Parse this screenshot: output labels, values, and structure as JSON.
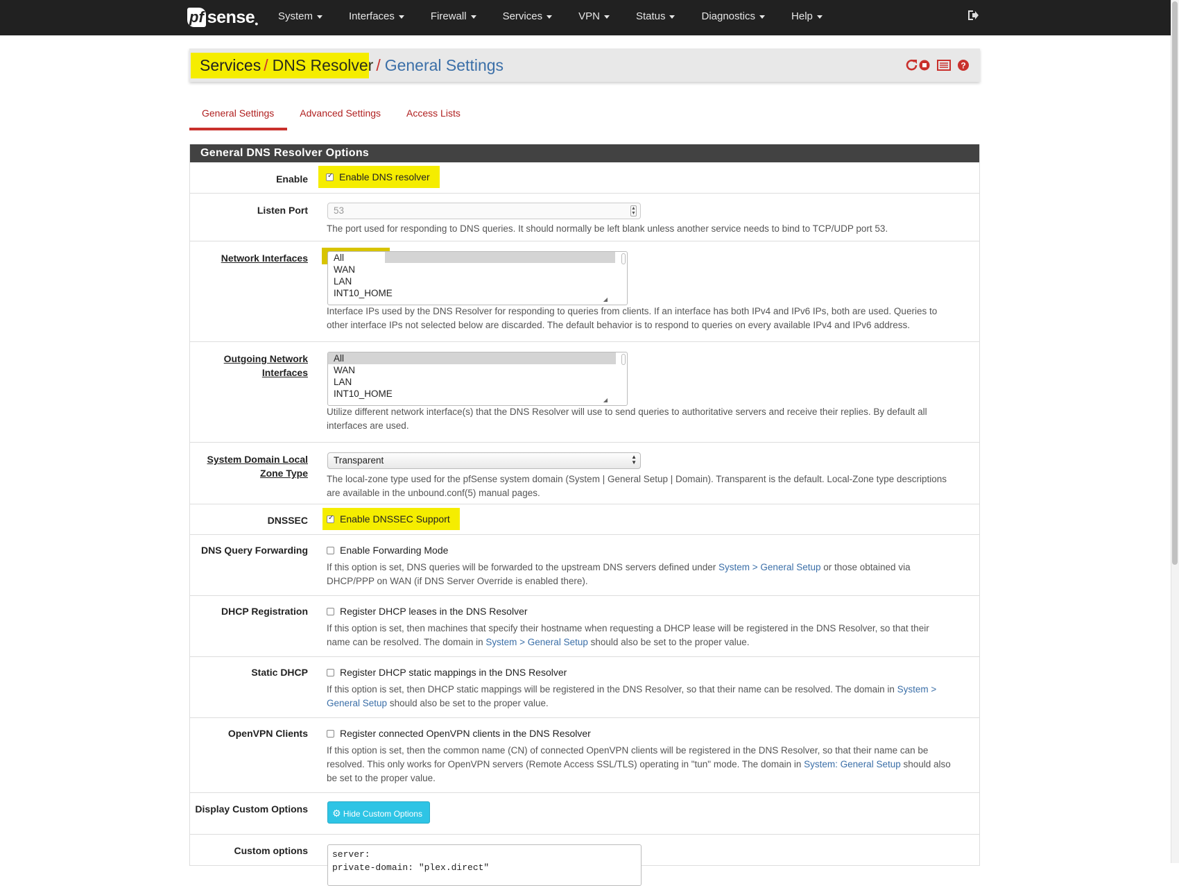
{
  "brand": {
    "pf": "pf",
    "sense": "sense"
  },
  "nav": {
    "items": [
      "System",
      "Interfaces",
      "Firewall",
      "Services",
      "VPN",
      "Status",
      "Diagnostics",
      "Help"
    ]
  },
  "breadcrumb": {
    "part1": "Services",
    "part2": "DNS Resolver",
    "part3": "General Settings",
    "separator": "/"
  },
  "tabs": [
    "General Settings",
    "Advanced Settings",
    "Access Lists"
  ],
  "panel": {
    "title": "General DNS Resolver Options"
  },
  "enable": {
    "label": "Enable",
    "checkbox_label": "Enable DNS resolver",
    "checked": true
  },
  "listen_port": {
    "label": "Listen Port",
    "placeholder": "53",
    "help": "The port used for responding to DNS queries. It should normally be left blank unless another service needs to bind to TCP/UDP port 53."
  },
  "network_interfaces": {
    "label": "Network Interfaces",
    "options": [
      "All",
      "WAN",
      "LAN",
      "INT10_HOME"
    ],
    "selected": "All",
    "help1": "Interface IPs used by the DNS Resolver for responding to queries from clients. If an interface has both IPv4 and IPv6 IPs, both are used. Queries to",
    "help2": "other interface IPs not selected below are discarded. The default behavior is to respond to queries on every available IPv4 and IPv6 address."
  },
  "outgoing_interfaces": {
    "label1": "Outgoing Network",
    "label2": "Interfaces",
    "options": [
      "All",
      "WAN",
      "LAN",
      "INT10_HOME"
    ],
    "selected": "All",
    "help1": "Utilize different network interface(s) that the DNS Resolver will use to send queries to authoritative servers and receive their replies. By default all",
    "help2": "interfaces are used."
  },
  "local_zone": {
    "label1": "System Domain Local",
    "label2": "Zone Type",
    "value": "Transparent",
    "help1": "The local-zone type used for the pfSense system domain (System | General Setup | Domain). Transparent is the default. Local-Zone type descriptions",
    "help2": "are available in the unbound.conf(5) manual pages."
  },
  "dnssec": {
    "label": "DNSSEC",
    "checkbox_label": "Enable DNSSEC Support",
    "checked": true
  },
  "forwarding": {
    "label": "DNS Query Forwarding",
    "checkbox_label": "Enable Forwarding Mode",
    "checked": false,
    "help1a": "If this option is set, DNS queries will be forwarded to the upstream DNS servers defined under ",
    "help1link": "System > General Setup",
    "help1b": " or those obtained via",
    "help2": "DHCP/PPP on WAN (if DNS Server Override is enabled there)."
  },
  "dhcp_registration": {
    "label": "DHCP Registration",
    "checkbox_label": "Register DHCP leases in the DNS Resolver",
    "checked": false,
    "help1": "If this option is set, then machines that specify their hostname when requesting a DHCP lease will be registered in the DNS Resolver, so that their",
    "help2a": "name can be resolved. The domain in ",
    "help2link": "System > General Setup",
    "help2b": " should also be set to the proper value."
  },
  "static_dhcp": {
    "label": "Static DHCP",
    "checkbox_label": "Register DHCP static mappings in the DNS Resolver",
    "checked": false,
    "help1a": "If this option is set, then DHCP static mappings will be registered in the DNS Resolver, so that their name can be resolved. The domain in ",
    "help1link": "System >",
    "help2link": "General Setup",
    "help2b": " should also be set to the proper value."
  },
  "openvpn": {
    "label": "OpenVPN Clients",
    "checkbox_label": "Register connected OpenVPN clients in the DNS Resolver",
    "checked": false,
    "help1": "If this option is set, then the common name (CN) of connected OpenVPN clients will be registered in the DNS Resolver, so that their name can be",
    "help2a": "resolved. This only works for OpenVPN servers (Remote Access SSL/TLS) operating in \"tun\" mode. The domain in ",
    "help2link": "System: General Setup",
    "help2b": " should also",
    "help3": "be set to the proper value."
  },
  "custom_display": {
    "label": "Display Custom Options",
    "button": "Hide Custom Options"
  },
  "custom_options": {
    "label": "Custom options",
    "line1": "server:",
    "line2": "private-domain: \"plex.direct\""
  },
  "colors": {
    "brand_red": "#c9302c",
    "highlight": "#f5ed00",
    "info_button": "#2ec4e5",
    "navbar": "#212121"
  }
}
